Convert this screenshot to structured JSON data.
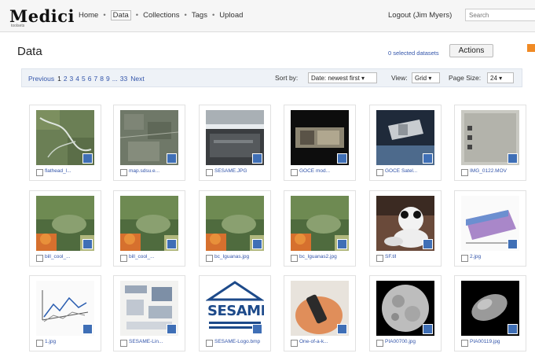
{
  "app": {
    "logo": "Medici",
    "logo_sub": "toolsets"
  },
  "nav": {
    "home": "Home",
    "data": "Data",
    "collections": "Collections",
    "tags": "Tags",
    "upload": "Upload"
  },
  "user": {
    "logout": "Logout (Jim Myers)",
    "search_placeholder": "Search"
  },
  "page": {
    "title": "Data",
    "selected_datasets": "0 selected datasets",
    "actions_label": "Actions"
  },
  "pager": {
    "previous": "Previous",
    "pages": [
      "1",
      "2",
      "3",
      "4",
      "5",
      "6",
      "7",
      "8",
      "9",
      "...",
      "33"
    ],
    "current": "1",
    "next": "Next"
  },
  "toolbar": {
    "sort_label": "Sort by:",
    "sort_value": "Date: newest first",
    "view_label": "View:",
    "view_value": "Grid",
    "pagesize_label": "Page Size:",
    "pagesize_value": "24"
  },
  "colors": {
    "link": "#3355aa",
    "accent": "#f08a24",
    "toolbar_bg": "#eef2f7"
  },
  "items": [
    {
      "name": "flathead_l...",
      "thumb": "aerial-river"
    },
    {
      "name": "map.sdsu.e...",
      "thumb": "aerial-town"
    },
    {
      "name": "SESAME.JPG",
      "thumb": "facility-interior"
    },
    {
      "name": "GOCE mod...",
      "thumb": "satellite-model"
    },
    {
      "name": "GOCE Satel...",
      "thumb": "satellite-space"
    },
    {
      "name": "IMG_0122.MOV",
      "thumb": "video"
    },
    {
      "name": "bill_cool_...",
      "thumb": "iguana"
    },
    {
      "name": "bill_cool_...",
      "thumb": "iguana"
    },
    {
      "name": "bc_Iguanas.jpg",
      "thumb": "iguana"
    },
    {
      "name": "bc_Iguanas2.jpg",
      "thumb": "iguana"
    },
    {
      "name": "SF.tif",
      "thumb": "panda"
    },
    {
      "name": "2.jpg",
      "thumb": "3d-plot"
    },
    {
      "name": "1.jpg",
      "thumb": "3d-graph"
    },
    {
      "name": "SESAME-Lin...",
      "thumb": "poster"
    },
    {
      "name": "SESAME-Logo.bmp",
      "thumb": "sesame-logo",
      "logo_text": "SESAMI"
    },
    {
      "name": "One-of-a-k...",
      "thumb": "hand-device"
    },
    {
      "name": "PIA00700.jpg",
      "thumb": "moon"
    },
    {
      "name": "PIA00119.jpg",
      "thumb": "asteroid"
    }
  ]
}
